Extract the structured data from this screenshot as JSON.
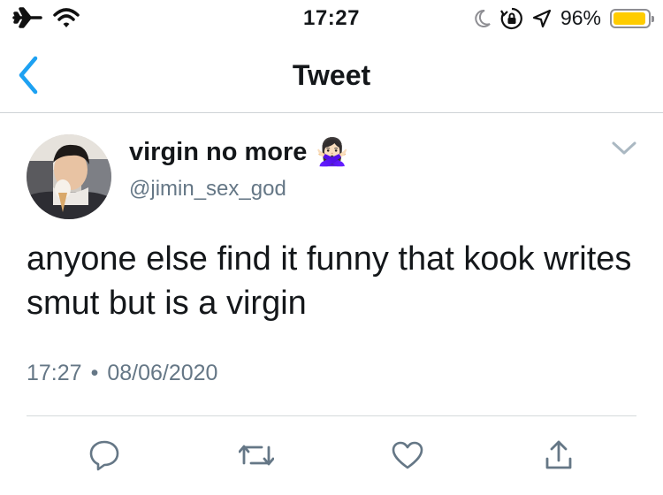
{
  "status_bar": {
    "time": "17:27",
    "battery_percent_text": "96%",
    "battery_level": 0.96,
    "battery_color": "#ffcc00",
    "icons": [
      "airplane-icon",
      "wifi-icon",
      "moon-icon",
      "rotation-lock-icon",
      "location-icon",
      "battery-icon"
    ]
  },
  "nav": {
    "title": "Tweet",
    "back_icon": "chevron-left-icon",
    "accent_color": "#1da1f2"
  },
  "tweet": {
    "display_name": "virgin no more",
    "name_emoji": "🙅🏻‍♀️",
    "handle": "@jimin_sex_god",
    "text": "anyone else find it funny that kook writes smut but is a virgin",
    "time": "17:27",
    "separator": "•",
    "date": "08/06/2020"
  },
  "actions": [
    "reply-icon",
    "retweet-icon",
    "like-icon",
    "share-icon"
  ]
}
